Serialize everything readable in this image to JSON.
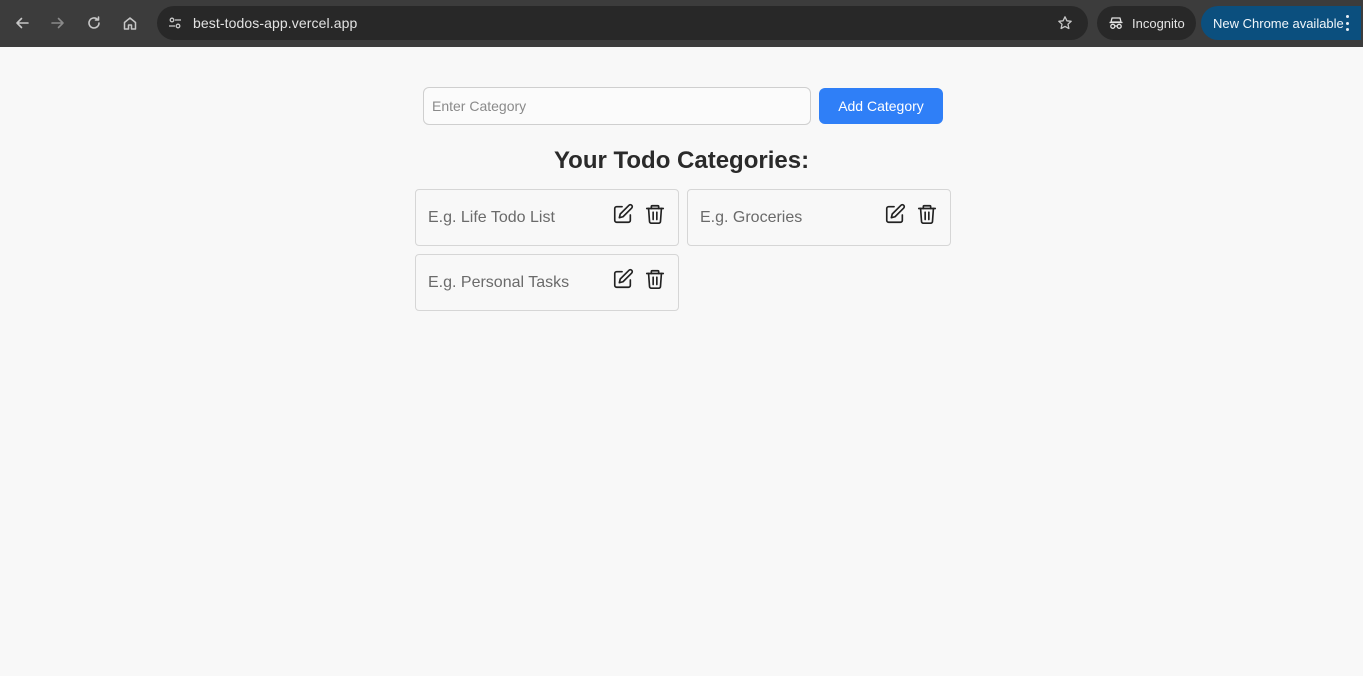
{
  "browser": {
    "url": "best-todos-app.vercel.app",
    "incognito_label": "Incognito",
    "update_label": "New Chrome available"
  },
  "form": {
    "input_value": "",
    "input_placeholder": "Enter Category",
    "add_button_label": "Add Category"
  },
  "heading": "Your Todo Categories:",
  "categories": [
    {
      "name": "E.g. Life Todo List"
    },
    {
      "name": "E.g. Groceries"
    },
    {
      "name": "E.g. Personal Tasks"
    }
  ],
  "icons": {
    "back": "arrow-left-icon",
    "forward": "arrow-right-icon",
    "reload": "reload-icon",
    "home": "home-icon",
    "site_info": "tune-icon",
    "bookmark": "star-icon",
    "incognito": "incognito-icon",
    "menu": "kebab-menu-icon",
    "edit": "edit-icon",
    "delete": "trash-icon"
  },
  "colors": {
    "accent": "#2f7ff7",
    "chrome_bg": "#3c3c3c",
    "update_chip": "#0b4f7e"
  }
}
